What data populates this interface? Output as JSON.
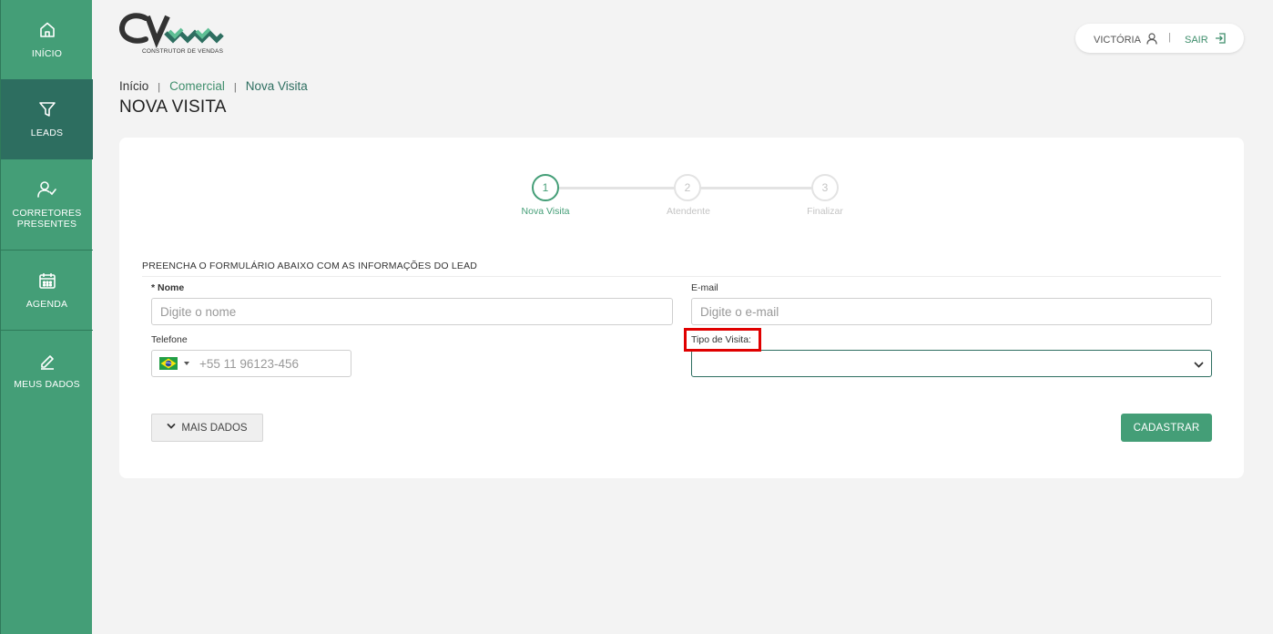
{
  "sidebar": {
    "items": [
      {
        "label": "INÍCIO",
        "icon": "home-icon"
      },
      {
        "label": "LEADS",
        "icon": "funnel-icon"
      },
      {
        "label": "CORRETORES PRESENTES",
        "icon": "user-check-icon"
      },
      {
        "label": "AGENDA",
        "icon": "calendar-icon"
      },
      {
        "label": "MEUS DADOS",
        "icon": "edit-icon"
      }
    ]
  },
  "header": {
    "logo_tagline": "CONSTRUTOR DE VENDAS",
    "user_name": "VICTÓRIA",
    "divider": "|",
    "logout_label": "SAIR"
  },
  "breadcrumb": {
    "home": "Início",
    "section": "Comercial",
    "current": "Nova Visita",
    "separator": "|"
  },
  "page": {
    "title": "NOVA VISITA"
  },
  "steps": [
    {
      "number": "1",
      "label": "Nova Visita"
    },
    {
      "number": "2",
      "label": "Atendente"
    },
    {
      "number": "3",
      "label": "Finalizar"
    }
  ],
  "form": {
    "title": "PREENCHA O FORMULÁRIO ABAIXO COM AS INFORMAÇÕES DO LEAD",
    "name": {
      "required_mark": "*",
      "label": "Nome",
      "placeholder": "Digite o nome"
    },
    "email": {
      "label": "E-mail",
      "placeholder": "Digite o e-mail"
    },
    "phone": {
      "label": "Telefone",
      "placeholder": "+55 11 96123-456",
      "country": "Brasil"
    },
    "visit_type": {
      "label": "Tipo de Visita:",
      "value": ""
    },
    "more_button": "MAIS DADOS",
    "submit_button": "CADASTRAR"
  },
  "colors": {
    "sidebar": "#449e77",
    "sidebar_active": "#2d6e60",
    "accent": "#449e77",
    "highlight": "#e00000"
  }
}
